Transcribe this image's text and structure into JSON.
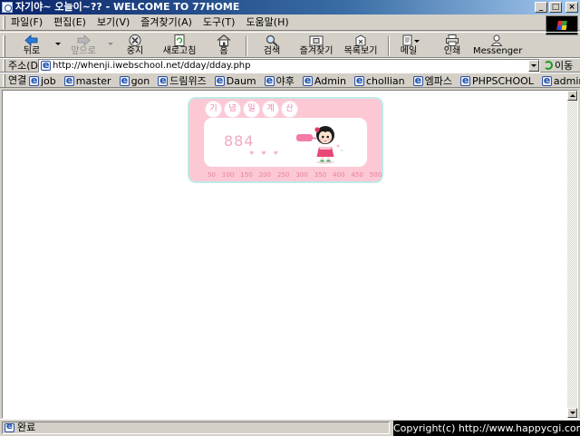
{
  "window": {
    "title": "자기야~ 오늘이~?? - WELCOME TO 77HOME",
    "minimize": "_",
    "maximize": "□",
    "close": "×"
  },
  "menu": [
    "파일(F)",
    "편집(E)",
    "보기(V)",
    "즐겨찾기(A)",
    "도구(T)",
    "도움말(H)"
  ],
  "toolbar": {
    "back": "뒤로",
    "forward": "앞으로",
    "stop": "중지",
    "refresh": "새로고침",
    "home": "홈",
    "search": "검색",
    "favorites": "즐겨찾기",
    "history": "목록보기",
    "mail": "메일",
    "print": "인쇄",
    "messenger": "Messenger"
  },
  "address": {
    "label": "주소(D)",
    "url": "http://whenji.iwebschool.net/dday/dday.php",
    "go": "이동"
  },
  "links": {
    "label": "연결",
    "items": [
      "job",
      "master",
      "gon",
      "드림위즈",
      "Daum",
      "야후",
      "Admin",
      "chollian",
      "엠파스",
      "PHPSCHOOL",
      "admin.php"
    ]
  },
  "counter": {
    "title_chars": [
      "기",
      "념",
      "일",
      "계",
      "산"
    ],
    "value": "884",
    "scale": [
      "50",
      "100",
      "150",
      "200",
      "250",
      "300",
      "350",
      "400",
      "450",
      "500"
    ],
    "colors": {
      "frame": "#fbc8d4",
      "border": "#bfeae8",
      "text": "#e9809e"
    }
  },
  "status": {
    "text": "완료",
    "copyright": "Copyright(c) http://www.happycgi.com"
  }
}
